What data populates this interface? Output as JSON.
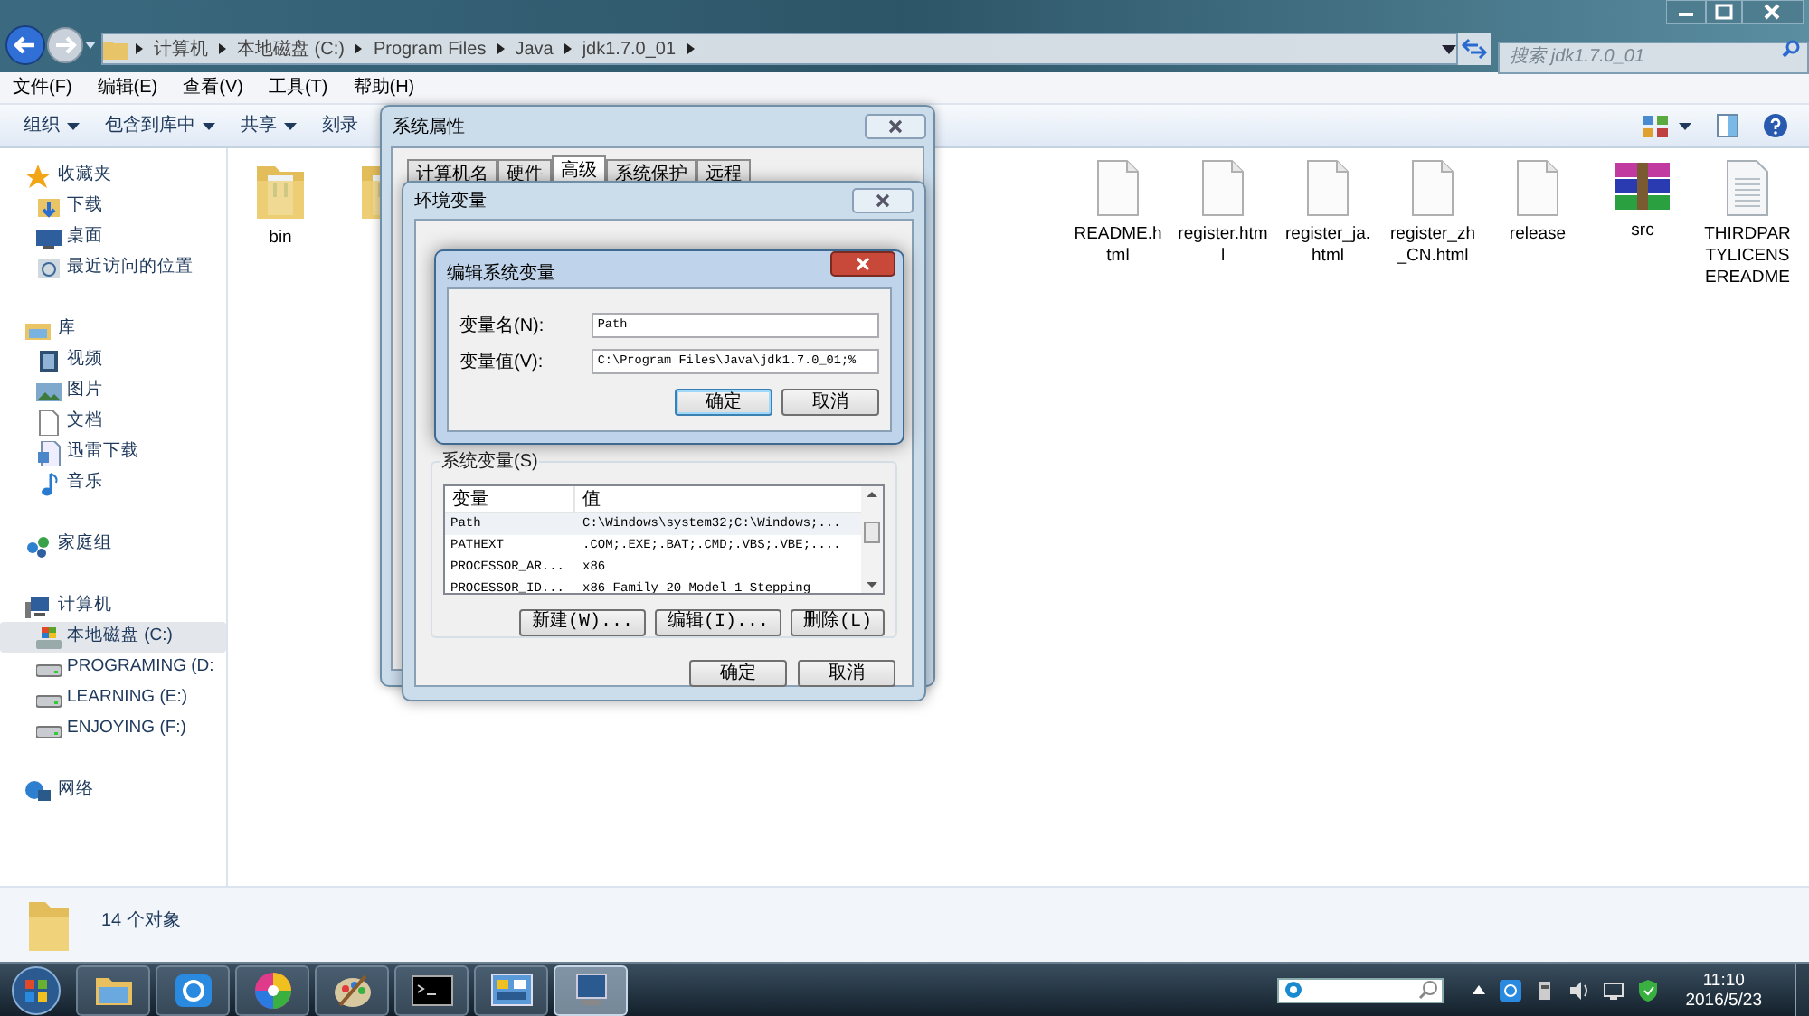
{
  "explorer": {
    "address_path": [
      "计算机",
      "本地磁盘 (C:)",
      "Program Files",
      "Java",
      "jdk1.7.0_01"
    ],
    "search": {
      "placeholder": "搜索 jdk1.7.0_01"
    },
    "menu": [
      "文件(F)",
      "编辑(E)",
      "查看(V)",
      "工具(T)",
      "帮助(H)"
    ],
    "toolbar": [
      {
        "label": "组织",
        "dropdown": true
      },
      {
        "label": "包含到库中",
        "dropdown": true
      },
      {
        "label": "共享",
        "dropdown": true
      },
      {
        "label": "刻录",
        "dropdown": false
      }
    ],
    "sidebar": [
      {
        "label": "收藏夹",
        "selected": false,
        "children": [
          {
            "label": "下载",
            "selected": false
          },
          {
            "label": "桌面",
            "selected": false
          },
          {
            "label": "最近访问的位置",
            "selected": false
          }
        ]
      },
      {
        "label": "库",
        "selected": false,
        "children": [
          {
            "label": "视频",
            "selected": false
          },
          {
            "label": "图片",
            "selected": false
          },
          {
            "label": "文档",
            "selected": false
          },
          {
            "label": "迅雷下载",
            "selected": false
          },
          {
            "label": "音乐",
            "selected": false
          }
        ]
      },
      {
        "label": "家庭组",
        "selected": false
      },
      {
        "label": "计算机",
        "selected": false,
        "children": [
          {
            "label": "本地磁盘 (C:)",
            "selected": true
          },
          {
            "label": "PROGRAMING (D:",
            "selected": false
          },
          {
            "label": "LEARNING (E:)",
            "selected": false
          },
          {
            "label": "ENJOYING (F:)",
            "selected": false
          }
        ]
      },
      {
        "label": "网络",
        "selected": false
      }
    ],
    "files": [
      {
        "kind": "folder",
        "label": "bin"
      },
      {
        "kind": "folder"
      },
      {
        "kind": "document",
        "label": "README.html"
      },
      {
        "kind": "document",
        "label": "register.html"
      },
      {
        "kind": "document",
        "label": "register_ja.html"
      },
      {
        "kind": "document",
        "label": "register_zh_CN.html"
      },
      {
        "kind": "document",
        "label": "release"
      },
      {
        "kind": "archive",
        "label": "src"
      },
      {
        "kind": "text",
        "label": "THIRDPARTYLICENSEREADME"
      }
    ],
    "status": "14 个对象"
  },
  "system_properties": {
    "title": "系统属性",
    "tabs": [
      {
        "label": "计算机名",
        "selected": false
      },
      {
        "label": "硬件",
        "selected": false
      },
      {
        "label": "高级",
        "selected": true
      },
      {
        "label": "系统保护",
        "selected": false
      },
      {
        "label": "远程",
        "selected": false
      }
    ]
  },
  "environment_variables": {
    "title": "环境变量",
    "system_variables": {
      "heading": "系统变量(S)",
      "columns": [
        "变量",
        "值"
      ],
      "rows": [
        {
          "name": "Path",
          "value": "C:\\Windows\\system32;C:\\Windows;...",
          "selected": true
        },
        {
          "name": "PATHEXT",
          "value": ".COM;.EXE;.BAT;.CMD;.VBS;.VBE;....",
          "selected": false
        },
        {
          "name": "PROCESSOR_AR...",
          "value": "x86",
          "selected": false
        },
        {
          "name": "PROCESSOR_ID...",
          "value": "x86 Family 20 Model 1 Stepping",
          "selected": false
        }
      ]
    },
    "buttons": [
      "新建(W)...",
      "编辑(I)...",
      "删除(L)"
    ],
    "footer_buttons": [
      "确定",
      "取消"
    ]
  },
  "edit_dialog": {
    "title": "编辑系统变量",
    "fields": [
      {
        "label": "变量名(N):",
        "value": "Path"
      },
      {
        "label": "变量值(V):",
        "value": "C:\\Program Files\\Java\\jdk1.7.0_01;%"
      }
    ],
    "buttons": [
      {
        "label": "确定",
        "default": true
      },
      {
        "label": "取消",
        "default": false
      }
    ]
  },
  "taskbar": {
    "apps": [
      {
        "selected": false
      },
      {
        "selected": false
      },
      {
        "selected": false
      },
      {
        "selected": false
      },
      {
        "selected": false
      },
      {
        "selected": false
      },
      {
        "selected": true
      }
    ],
    "clock": {
      "time": "11:10",
      "date": "2016/5/23"
    }
  }
}
